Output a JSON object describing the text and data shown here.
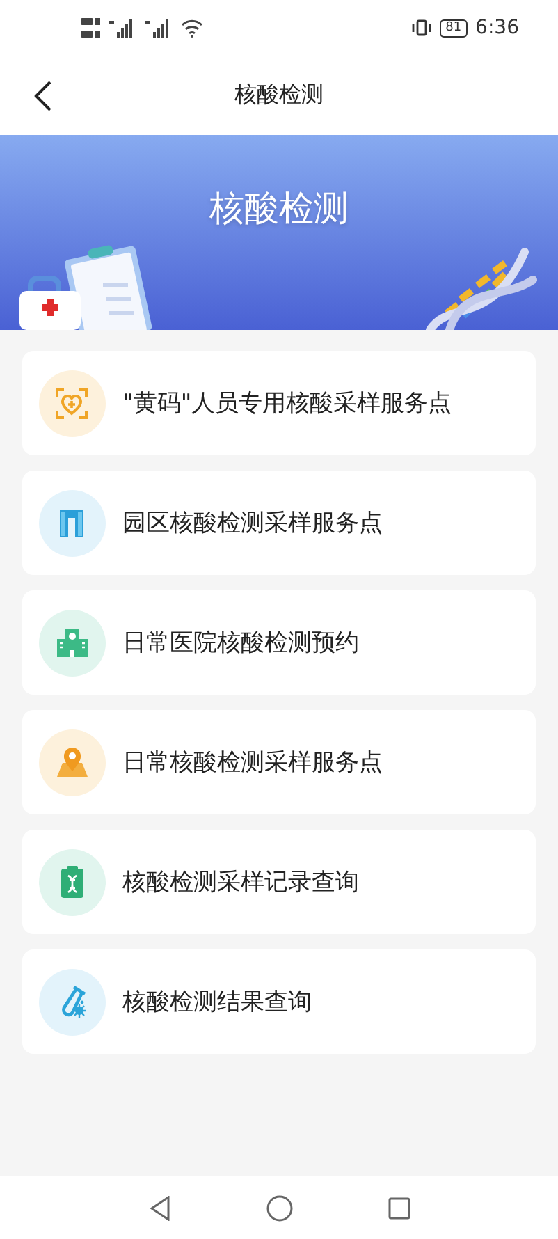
{
  "status_bar": {
    "battery": "81",
    "time": "6:36"
  },
  "header": {
    "title": "核酸检测"
  },
  "banner": {
    "title": "核酸检测"
  },
  "items": [
    {
      "label": "\"黄码\"人员专用核酸采样服务点",
      "kind": "health-code",
      "color": "#fdf1dc"
    },
    {
      "label": "园区核酸检测采样服务点",
      "kind": "park",
      "color": "#e3f3fb"
    },
    {
      "label": "日常医院核酸检测预约",
      "kind": "hospital",
      "color": "#e1f5ee"
    },
    {
      "label": "日常核酸检测采样服务点",
      "kind": "location",
      "color": "#fdf1dc"
    },
    {
      "label": "核酸检测采样记录查询",
      "kind": "record",
      "color": "#e1f5ee"
    },
    {
      "label": "核酸检测结果查询",
      "kind": "result",
      "color": "#e3f3fb"
    }
  ]
}
